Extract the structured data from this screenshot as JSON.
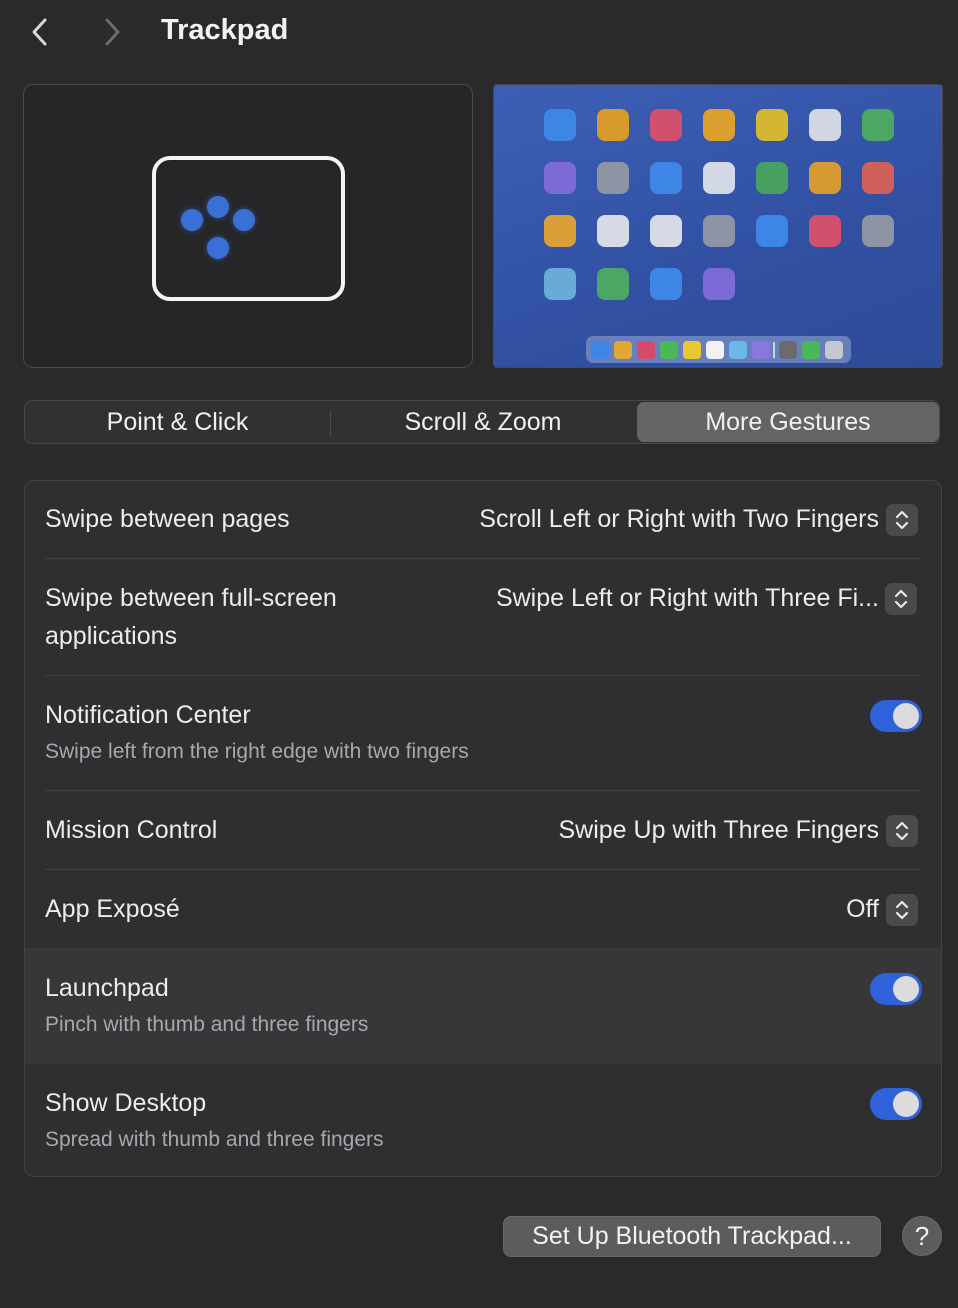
{
  "header": {
    "title": "Trackpad",
    "back_icon": "chevron-left-icon",
    "forward_icon": "chevron-right-icon"
  },
  "colors": {
    "accent": "#2f62d8",
    "background": "#2a2a2c",
    "panel": "#2f2f31"
  },
  "tabs": [
    {
      "label": "Point & Click",
      "selected": false
    },
    {
      "label": "Scroll & Zoom",
      "selected": false
    },
    {
      "label": "More Gestures",
      "selected": true
    }
  ],
  "settings": {
    "swipe_pages": {
      "label": "Swipe between pages",
      "value": "Scroll Left or Right with Two Fingers"
    },
    "swipe_fullscreen": {
      "label_line1": "Swipe between full-screen",
      "label_line2": "applications",
      "value": "Swipe Left or Right with Three Fi..."
    },
    "notification_center": {
      "label": "Notification Center",
      "sublabel": "Swipe left from the right edge with two fingers",
      "enabled": true
    },
    "mission_control": {
      "label": "Mission Control",
      "value": "Swipe Up with Three Fingers"
    },
    "app_expose": {
      "label": "App Exposé",
      "value": "Off"
    },
    "launchpad": {
      "label": "Launchpad",
      "sublabel": "Pinch with thumb and three fingers",
      "enabled": true
    },
    "show_desktop": {
      "label": "Show Desktop",
      "sublabel": "Spread with thumb and three fingers",
      "enabled": true
    }
  },
  "footer": {
    "bluetooth_button": "Set Up Bluetooth Trackpad...",
    "help_button": "?"
  }
}
